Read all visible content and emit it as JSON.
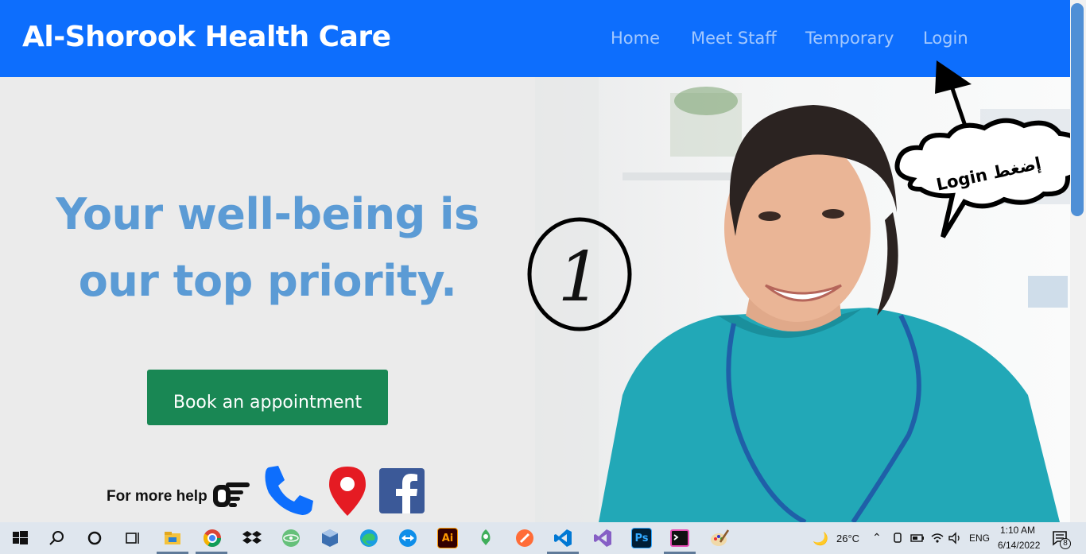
{
  "navbar": {
    "brand": "Al-Shorook Health Care",
    "links": [
      "Home",
      "Meet Staff",
      "Temporary",
      "Login"
    ]
  },
  "hero": {
    "headline_line1": "Your well-being is",
    "headline_line2": "our top priority.",
    "cta_label": "Book an appointment",
    "help_text": "For more help"
  },
  "annotation": {
    "step_number": "1",
    "bubble_text": "Login إضغط"
  },
  "taskbar": {
    "apps": [
      "windows-start",
      "search",
      "cortana",
      "task-view",
      "file-explorer",
      "chrome",
      "dropbox",
      "atom",
      "virtualbox",
      "edge",
      "teamviewer",
      "illustrator",
      "git-kraken",
      "postman",
      "vscode",
      "visual-studio",
      "photoshop",
      "terminal",
      "paint"
    ],
    "illustrator_label": "Ai",
    "photoshop_label": "Ps",
    "weather": "26°C",
    "language": "ENG",
    "time": "1:10 AM",
    "date": "6/14/2022",
    "notification_count": "8"
  },
  "colors": {
    "navbar": "#0d6efd",
    "headline": "#5b9bd5",
    "cta": "#198754",
    "phone": "#0d6efd",
    "location": "#e51b23",
    "facebook": "#3b5998"
  }
}
